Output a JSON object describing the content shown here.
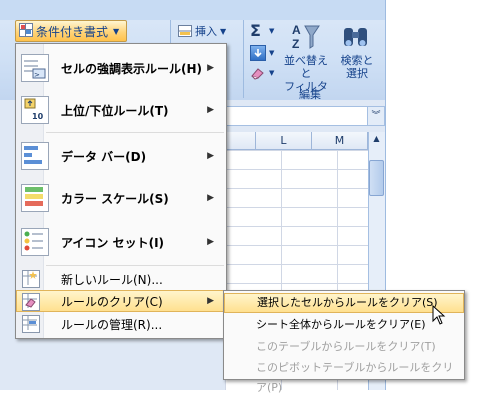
{
  "ribbon": {
    "conditional_formatting_label": "条件付き書式",
    "insert_label": "挿入",
    "sort_filter_label": "並べ替えと\nフィルタ",
    "find_select_label": "検索と\n選択",
    "editing_group_label": "編集",
    "sum_glyph": "Σ"
  },
  "grid": {
    "columns": [
      "L",
      "M"
    ]
  },
  "menu": {
    "items": [
      {
        "label": "セルの強調表示ルール(H)",
        "icon": "highlight-cells-icon"
      },
      {
        "label": "上位/下位ルール(T)",
        "icon": "top-bottom-icon"
      },
      {
        "label": "データ バー(D)",
        "icon": "data-bars-icon"
      },
      {
        "label": "カラー スケール(S)",
        "icon": "color-scales-icon"
      },
      {
        "label": "アイコン セット(I)",
        "icon": "icon-sets-icon"
      },
      {
        "label": "新しいルール(N)...",
        "icon": "new-rule-icon"
      },
      {
        "label": "ルールのクリア(C)",
        "icon": "clear-rules-icon"
      },
      {
        "label": "ルールの管理(R)...",
        "icon": "manage-rules-icon"
      }
    ]
  },
  "submenu": {
    "items": [
      {
        "label": "選択したセルからルールをクリア(S)",
        "enabled": true
      },
      {
        "label": "シート全体からルールをクリア(E)",
        "enabled": true
      },
      {
        "label": "このテーブルからルールをクリア(T)",
        "enabled": false
      },
      {
        "label": "このピボットテーブルからルールをクリア(P)",
        "enabled": false
      }
    ]
  },
  "colors": {
    "highlight": "#ffe08f",
    "ribbon_text": "#15428b"
  }
}
